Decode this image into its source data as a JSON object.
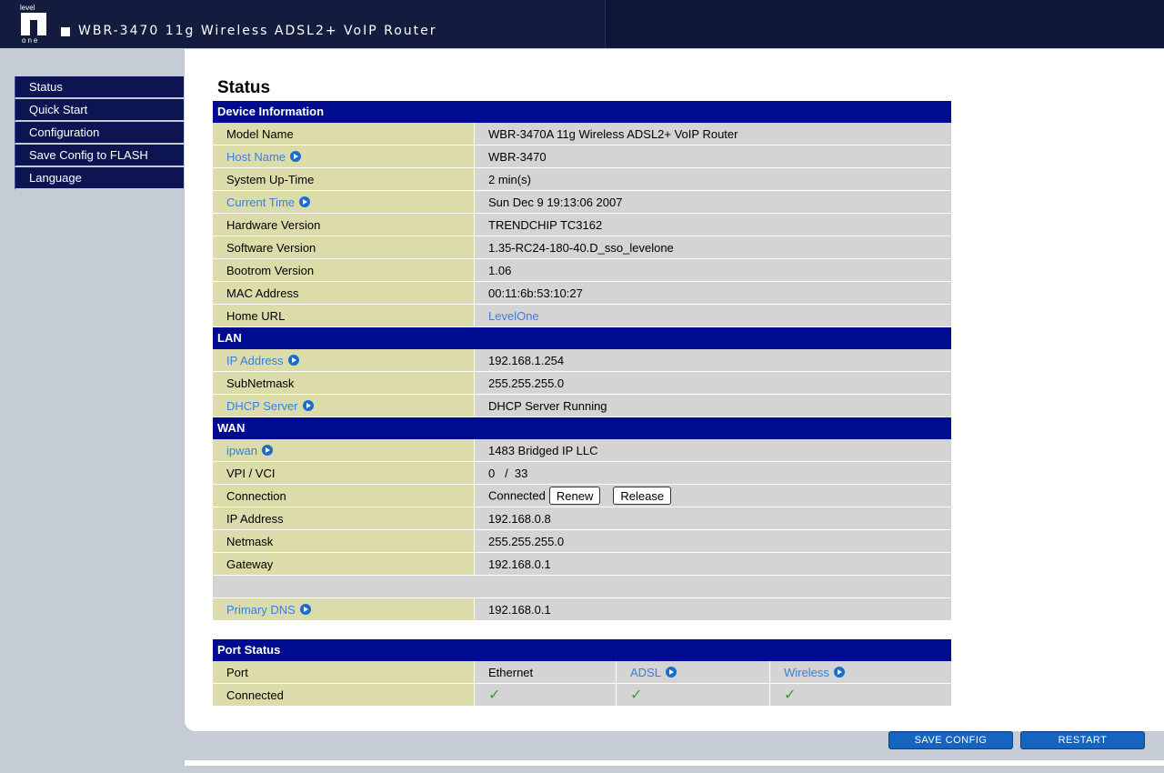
{
  "header": {
    "logo_top": "level",
    "logo_bottom": "one",
    "app_title": "WBR-3470 11g Wireless ADSL2+ VoIP Router"
  },
  "sidebar": {
    "items": [
      {
        "label": "Status"
      },
      {
        "label": "Quick Start"
      },
      {
        "label": "Configuration"
      },
      {
        "label": "Save Config to FLASH"
      },
      {
        "label": "Language"
      }
    ]
  },
  "page": {
    "title": "Status"
  },
  "device": {
    "header": "Device Information",
    "rows": [
      {
        "label": "Model Name",
        "value": "WBR-3470A 11g Wireless ADSL2+ VoIP Router"
      },
      {
        "label": "Host Name",
        "value": "WBR-3470"
      },
      {
        "label": "System Up-Time",
        "value": "2 min(s)"
      },
      {
        "label": "Current Time",
        "value": "Sun Dec 9 19:13:06 2007"
      },
      {
        "label": "Hardware Version",
        "value": "TRENDCHIP TC3162"
      },
      {
        "label": "Software Version",
        "value": "1.35-RC24-180-40.D_sso_levelone"
      },
      {
        "label": "Bootrom Version",
        "value": "1.06"
      },
      {
        "label": "MAC Address",
        "value": "00:11:6b:53:10:27"
      },
      {
        "label": "Home URL",
        "value": "LevelOne"
      }
    ]
  },
  "lan": {
    "header": "LAN",
    "rows": [
      {
        "label": "IP Address",
        "value": "192.168.1.254"
      },
      {
        "label": "SubNetmask",
        "value": "255.255.255.0"
      },
      {
        "label": "DHCP Server",
        "value": "DHCP Server Running"
      }
    ]
  },
  "wan": {
    "header": "WAN",
    "rows": [
      {
        "label": "ipwan",
        "value": "1483 Bridged IP LLC"
      },
      {
        "label": "VPI / VCI",
        "value": "0   /  33"
      },
      {
        "label": "Connection",
        "value": "Connected"
      },
      {
        "label": "IP Address",
        "value": "192.168.0.8"
      },
      {
        "label": "Netmask",
        "value": "255.255.255.0"
      },
      {
        "label": "Gateway",
        "value": "192.168.0.1"
      },
      {
        "label": "Primary DNS",
        "value": "192.168.0.1"
      }
    ],
    "renew_label": "Renew",
    "release_label": "Release"
  },
  "ports": {
    "header": "Port Status",
    "port_label": "Port",
    "connected_label": "Connected",
    "columns": [
      "Ethernet",
      "ADSL",
      "Wireless"
    ],
    "check": "✓"
  },
  "actions": {
    "save_label": "SAVE CONFIG",
    "restart_label": "RESTART"
  }
}
